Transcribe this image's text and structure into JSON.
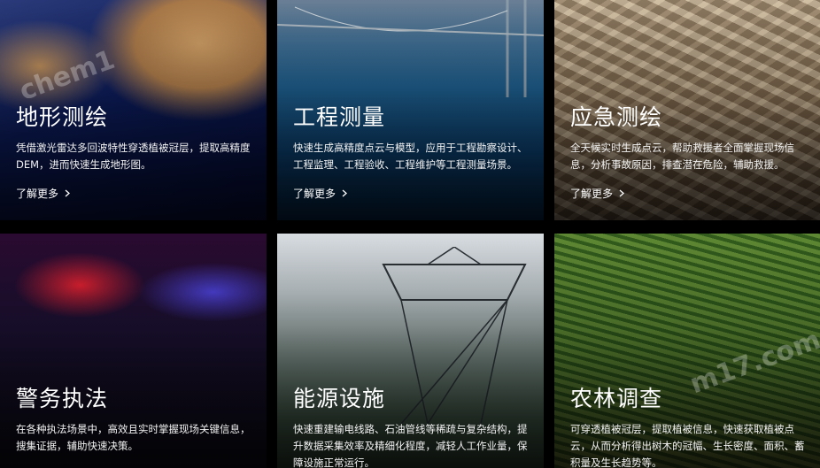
{
  "cards": [
    {
      "title": "地形测绘",
      "desc": "凭借激光雷达多回波特性穿透植被冠层，提取高精度 DEM，进而快速生成地形图。",
      "more": "了解更多"
    },
    {
      "title": "工程测量",
      "desc": "快速生成高精度点云与模型，应用于工程勘察设计、工程监理、工程验收、工程维护等工程测量场景。",
      "more": "了解更多"
    },
    {
      "title": "应急测绘",
      "desc": "全天候实时生成点云，帮助救援者全面掌握现场信息，分析事故原因，排查潜在危险，辅助救援。",
      "more": "了解更多"
    },
    {
      "title": "警务执法",
      "desc": "在各种执法场景中，高效且实时掌握现场关键信息，搜集证据，辅助快速决策。"
    },
    {
      "title": "能源设施",
      "desc": "快速重建输电线路、石油管线等稀疏与复杂结构，提升数据采集效率及精细化程度，减轻人工作业量，保障设施正常运行。"
    },
    {
      "title": "农林调查",
      "desc": "可穿透植被冠层，提取植被信息，快速获取植被点云，从而分析得出树木的冠幅、生长密度、面积、蓄积量及生长趋势等。"
    }
  ],
  "watermarks": [
    "chem1",
    "m17.com"
  ]
}
